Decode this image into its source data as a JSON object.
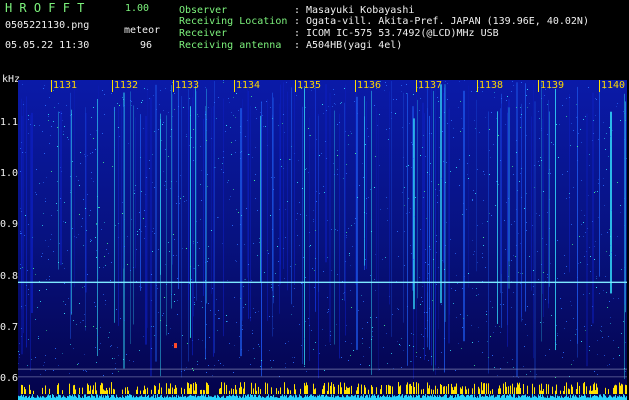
{
  "header": {
    "app_name": "HROFFT",
    "version": "1.00",
    "filename": "0505221130.png",
    "counter_label": "meteor",
    "counter_value": "96",
    "datetime": "05.05.22 11:30"
  },
  "info": [
    {
      "label": "Observer",
      "sep": ":",
      "value": "Masayuki Kobayashi"
    },
    {
      "label": "Receiving Location",
      "sep": ":",
      "value": "Ogata-vill. Akita-Pref. JAPAN (139.96E, 40.02N)"
    },
    {
      "label": "Receiver",
      "sep": ":",
      "value": "ICOM IC-575 53.7492(@LCD)MHz USB"
    },
    {
      "label": "Receiving antenna",
      "sep": ":",
      "value": "A504HB(yagi 4el)"
    }
  ],
  "colors": {
    "label_green": "#7cf27c",
    "text_white": "#f0f0f0",
    "minute_yellow": "#ffd800",
    "spectrum_dark": "#04034a",
    "spectrum_mid": "#0d1fbf",
    "spectrum_bright": "#35e6ff"
  },
  "chart_data": {
    "type": "heatmap",
    "ylabel": "kHz",
    "y_ticks": [
      "1.1",
      "1.0",
      "0.9",
      "0.8",
      "0.7",
      "0.6"
    ],
    "y_values": [
      1.1,
      1.0,
      0.9,
      0.8,
      0.7,
      0.6
    ],
    "ylim": [
      0.59,
      1.18
    ],
    "x_ticks": [
      "1131",
      "1132",
      "1133",
      "1134",
      "1135",
      "1136",
      "1137",
      "1138",
      "1139",
      "1140"
    ],
    "xlim_minutes": [
      "1130",
      "1140"
    ],
    "carrier_line_khz": 0.79,
    "meteor_count": 96,
    "grid": false,
    "legend": "none"
  }
}
